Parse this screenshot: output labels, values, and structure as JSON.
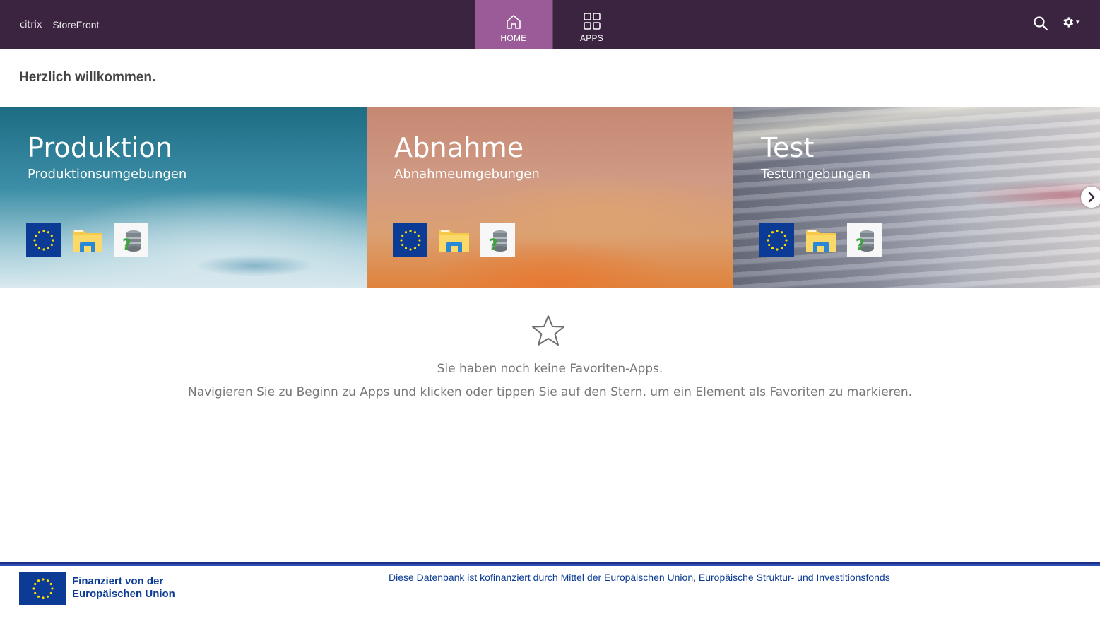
{
  "header": {
    "brand_mark": "citrix",
    "brand_name": "StoreFront",
    "nav": [
      {
        "label": "HOME",
        "icon": "home-icon",
        "active": true
      },
      {
        "label": "APPS",
        "icon": "apps-grid-icon",
        "active": false
      }
    ],
    "tools": {
      "search_icon": "search-icon",
      "settings_icon": "gear-icon",
      "settings_caret": "▾"
    }
  },
  "welcome": "Herzlich willkommen.",
  "categories": [
    {
      "title": "Produktion",
      "subtitle": "Produktionsumgebungen",
      "apps": [
        "eu-flag-icon",
        "folder-icon",
        "database-help-icon"
      ]
    },
    {
      "title": "Abnahme",
      "subtitle": "Abnahmeumgebungen",
      "apps": [
        "eu-flag-icon",
        "folder-icon",
        "database-help-icon"
      ]
    },
    {
      "title": "Test",
      "subtitle": "Testumgebungen",
      "apps": [
        "eu-flag-icon",
        "folder-icon",
        "database-help-icon"
      ]
    }
  ],
  "favorites": {
    "icon": "star-icon",
    "empty_title": "Sie haben noch keine Favoriten-Apps.",
    "empty_hint": "Navigieren Sie zu Beginn zu Apps und klicken oder tippen Sie auf den Stern, um ein Element als Favoriten zu markieren."
  },
  "footer": {
    "eu_line1": "Finanziert von der",
    "eu_line2": "Europäischen Union",
    "note": "Diese Datenbank ist kofinanziert durch Mittel der Europäischen Union, Europäische Struktur- und Investitionsfonds"
  },
  "colors": {
    "header_bg": "#3b2440",
    "active_tab": "#9b5b98",
    "eu_blue": "#0b3b94",
    "eu_yellow": "#ffdd00"
  }
}
